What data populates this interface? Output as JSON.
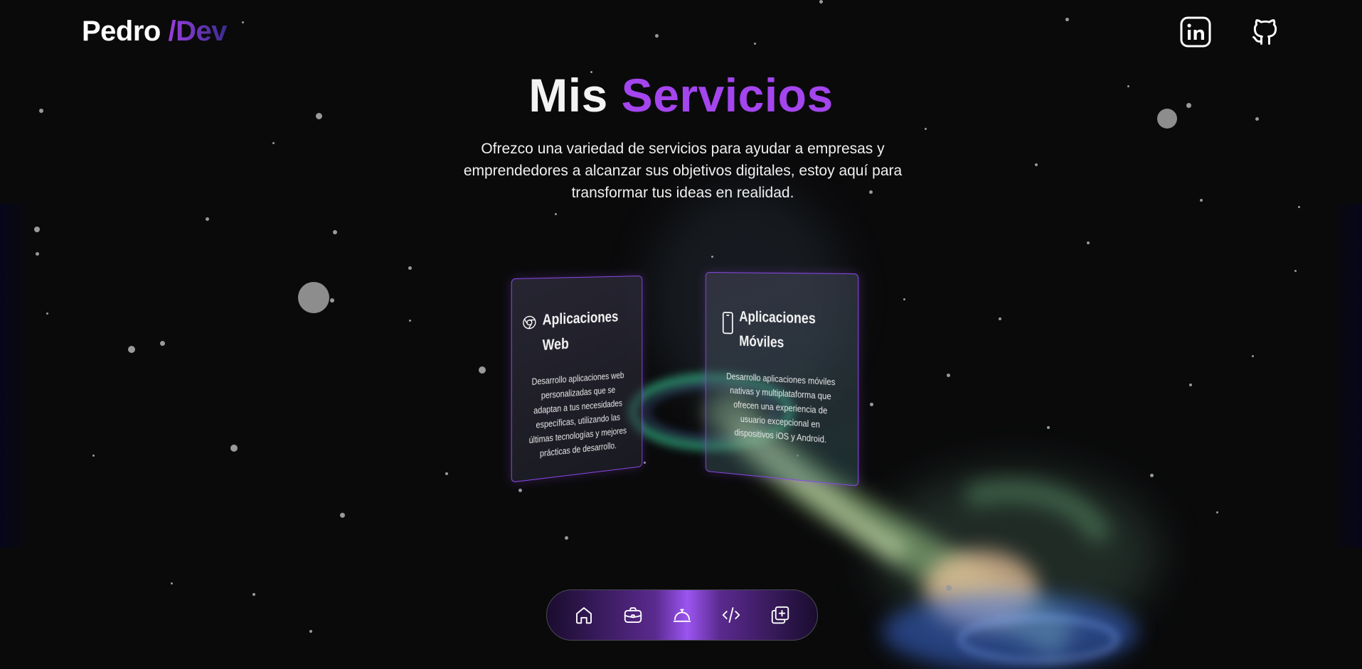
{
  "header": {
    "logo_name": "Pedro",
    "logo_suffix": "/Dev",
    "social": [
      {
        "icon": "linkedin-icon"
      },
      {
        "icon": "github-icon"
      }
    ]
  },
  "hero": {
    "title_word1": "Mis",
    "title_word2": "Servicios",
    "subtitle": "Ofrezco una variedad de servicios para ayudar a empresas y emprendedores a alcanzar sus objetivos digitales, estoy aquí para transformar tus ideas en realidad."
  },
  "services": [
    {
      "icon": "chrome-icon",
      "title_line1": "Aplicaciones",
      "title_line2": "Web",
      "description": "Desarrollo aplicaciones web personalizadas que se adaptan a tus necesidades específicas, utilizando las últimas tecnologías y mejores prácticas de desarrollo."
    },
    {
      "icon": "smartphone-icon",
      "title_line1": "Aplicaciones",
      "title_line2": "Móviles",
      "description": "Desarrollo aplicaciones móviles nativas y multiplataforma que ofrecen una experiencia de usuario excepcional en dispositivos iOS y Android."
    }
  ],
  "dock": {
    "items": [
      {
        "icon": "home-icon"
      },
      {
        "icon": "briefcase-icon"
      },
      {
        "icon": "service-bell-icon",
        "active": true
      },
      {
        "icon": "code-icon"
      },
      {
        "icon": "add-square-icon"
      }
    ]
  },
  "colors": {
    "background": "#0a0a0b",
    "accent": "#a445ee",
    "card_border": "#8b46e8"
  }
}
